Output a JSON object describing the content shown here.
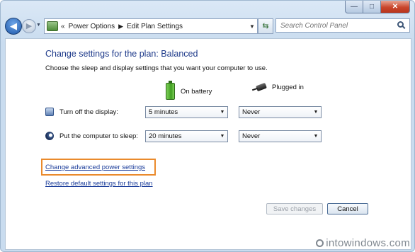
{
  "window": {
    "caption_icons": [
      "minimize-icon",
      "maximize-icon",
      "close-icon"
    ]
  },
  "nav": {
    "breadcrumb": [
      "Power Options",
      "Edit Plan Settings"
    ],
    "crumb_chevron": "«",
    "search_placeholder": "Search Control Panel"
  },
  "main": {
    "title": "Change settings for the plan: Balanced",
    "subtitle": "Choose the sleep and display settings that you want your computer to use.",
    "columns": {
      "battery": "On battery",
      "plugged": "Plugged in"
    },
    "rows": [
      {
        "label": "Turn off the display:",
        "battery": "5 minutes",
        "plugged": "Never"
      },
      {
        "label": "Put the computer to sleep:",
        "battery": "20 minutes",
        "plugged": "Never"
      }
    ],
    "links": {
      "advanced": "Change advanced power settings",
      "restore": "Restore default settings for this plan"
    },
    "buttons": {
      "save": "Save changes",
      "cancel": "Cancel"
    }
  },
  "watermark": "intowindows.com",
  "colors": {
    "title": "#1e3a8a",
    "link": "#1a3c9a",
    "highlight": "#ea8a2c",
    "close_button": "#c9462c"
  }
}
